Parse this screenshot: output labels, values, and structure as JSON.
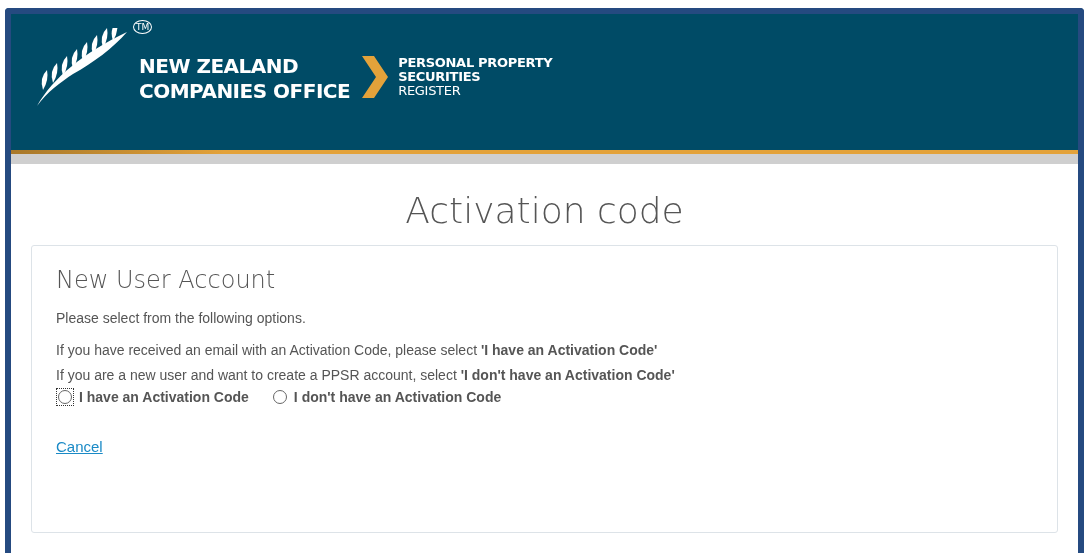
{
  "header": {
    "logo_line_1": "NEW ZEALAND",
    "logo_line_2": "COMPANIES OFFICE",
    "trademark": "TM",
    "register_line_1": "PERSONAL PROPERTY",
    "register_line_2": "SECURITIES",
    "register_line_3": "REGISTER"
  },
  "page_title": "Activation code",
  "card": {
    "title": "New User Account",
    "intro": "Please select from the following options.",
    "instructions": [
      "If you have received an email with an Activation Code, please select **'I have an Activation Code'**",
      "If you are a new user and want to create a PPSR account, select **'I don't have an Activation Code'**"
    ],
    "options": [
      {
        "label": "I have an Activation Code",
        "selected": false,
        "focused": true
      },
      {
        "label": "I don't have an Activation Code",
        "selected": false,
        "focused": false
      }
    ],
    "cancel_link": "Cancel"
  }
}
